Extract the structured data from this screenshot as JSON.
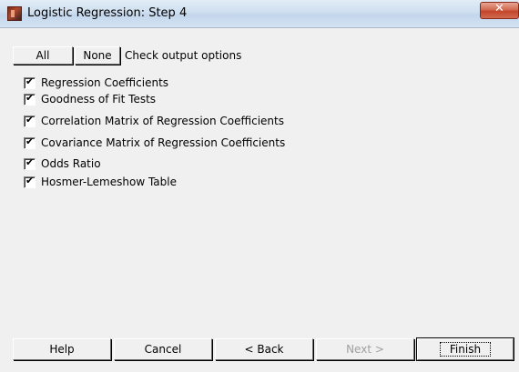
{
  "window": {
    "title": "Logistic Regression: Step 4",
    "close_glyph": "✕"
  },
  "toolbar": {
    "all_label": "All",
    "none_label": "None",
    "check_label": "Check output options"
  },
  "options": [
    {
      "label": "Regression Coefficients",
      "checked": true
    },
    {
      "label": "Goodness of Fit Tests",
      "checked": true
    },
    {
      "label": "Correlation Matrix of Regression Coefficients",
      "checked": true
    },
    {
      "label": "Covariance Matrix of Regression Coefficients",
      "checked": true
    },
    {
      "label": "Odds Ratio",
      "checked": true
    },
    {
      "label": "Hosmer-Lemeshow Table",
      "checked": true
    }
  ],
  "footer": {
    "help_label": "Help",
    "cancel_label": "Cancel",
    "back_label": "< Back",
    "next_label": "Next >",
    "finish_label": "Finish"
  },
  "icons": {
    "app": "app-icon",
    "close": "close-icon"
  }
}
